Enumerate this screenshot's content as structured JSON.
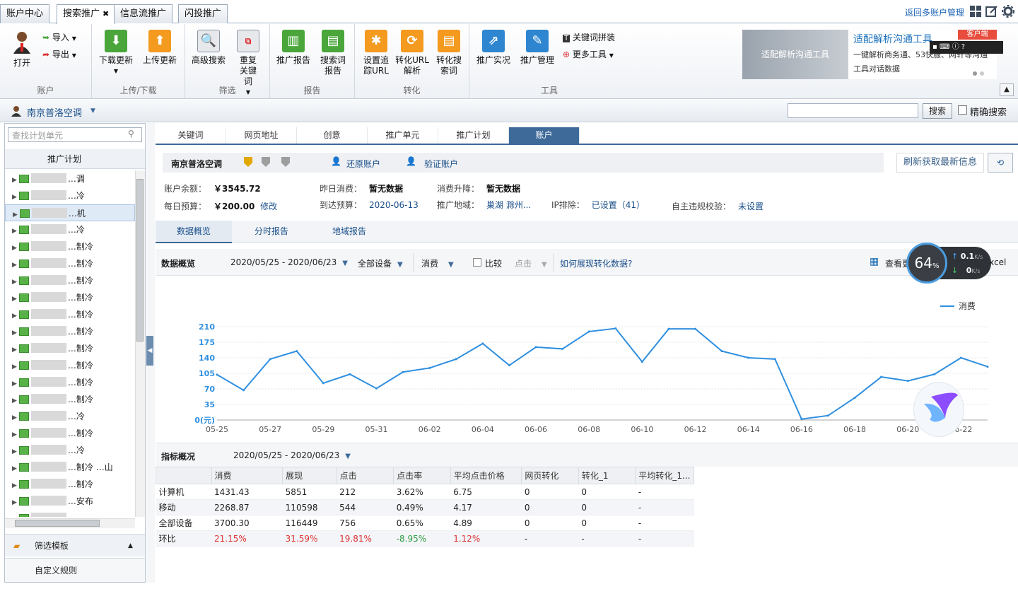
{
  "top_tabs": [
    {
      "label": "账户中心",
      "active": false
    },
    {
      "label": "搜索推广",
      "active": true,
      "closable": true
    },
    {
      "label": "信息流推广",
      "active": false
    },
    {
      "label": "闪投推广",
      "active": false
    }
  ],
  "top_right": {
    "back_link": "返回多账户管理"
  },
  "ribbon": {
    "groups": [
      {
        "label": "账户",
        "items": [
          "打开",
          "导入",
          "导出"
        ]
      },
      {
        "label": "上传/下载",
        "items": [
          "下载更新",
          "上传更新"
        ]
      },
      {
        "label": "筛选",
        "items": [
          "高级搜索",
          "重复关键词"
        ]
      },
      {
        "label": "报告",
        "items": [
          "推广报告",
          "搜索词报告"
        ]
      },
      {
        "label": "转化",
        "items": [
          "设置追踪URL",
          "转化URL解析",
          "转化搜索词"
        ]
      },
      {
        "label": "工具",
        "items": [
          "推广实况",
          "推广管理",
          "关键词拼装",
          "更多工具"
        ]
      }
    ],
    "banner": {
      "image_text": "适配解析沟通工具",
      "title": "适配解析沟通工具",
      "desc": "一键解析商务通、53快服、网轩等沟通工具对话数据",
      "badge": "客户端"
    }
  },
  "account_bar": {
    "name": "南京普洛空调",
    "search_btn": "搜索",
    "exact_label": "精确搜索"
  },
  "sidebar": {
    "search_placeholder": "查找计划单元",
    "header": "推广计划",
    "items": [
      "…调",
      "…冷",
      "…机",
      "…冷",
      "…制冷",
      "…制冷",
      "…制冷",
      "…制冷",
      "…制冷",
      "…制冷",
      "…制冷",
      "…制冷",
      "…制冷",
      "…制冷",
      "…冷",
      "…制冷",
      "…冷",
      "…制冷 …山",
      "…制冷",
      "…安布",
      "…",
      ""
    ],
    "selected_index": 2,
    "filter_template": "筛选模板",
    "custom_rules": "自定义规则"
  },
  "main": {
    "tabs": [
      "关键词",
      "网页地址",
      "创意",
      "推广单元",
      "推广计划",
      "账户"
    ],
    "active_tab": 5,
    "account_name": "南京普洛空调",
    "restore": "还原账户",
    "verify": "验证账户",
    "refresh": "刷新获取最新信息",
    "info": {
      "balance_label": "账户余额：",
      "balance": "￥3545.72",
      "yesterday_label": "昨日消费：",
      "yesterday": "暂无数据",
      "change_label": "消费升降：",
      "change": "暂无数据",
      "budget_label": "每日预算：",
      "budget": "￥200.00",
      "budget_edit": "修改",
      "reach_label": "到达预算：",
      "reach": "2020-06-13",
      "region_label": "推广地域：",
      "region": "巢湖 滁州...",
      "ip_label": "IP排除：",
      "ip": "已设置（41）",
      "selfcheck_label": "自主违规校验：",
      "selfcheck": "未设置"
    },
    "subtabs": [
      "数据概览",
      "分时报告",
      "地域报告"
    ],
    "controls": {
      "title": "数据概览",
      "date_range": "2020/05/25 - 2020/06/23",
      "device": "全部设备",
      "metric1": "消费",
      "compare": "比较",
      "metric2": "点击",
      "help": "如何展现转化数据?",
      "view_more": "查看更多",
      "excel": "excel"
    },
    "metrics_title": "指标概况",
    "metrics_date": "2020/05/25 - 2020/06/23",
    "table": {
      "headers": [
        "",
        "消费",
        "展现",
        "点击",
        "点击率",
        "平均点击价格",
        "网页转化",
        "转化_1",
        "平均转化_1..."
      ],
      "rows": [
        [
          "计算机",
          "1431.43",
          "5851",
          "212",
          "3.62%",
          "6.75",
          "0",
          "0",
          "-"
        ],
        [
          "移动",
          "2268.87",
          "110598",
          "544",
          "0.49%",
          "4.17",
          "0",
          "0",
          "-"
        ],
        [
          "全部设备",
          "3700.30",
          "116449",
          "756",
          "0.65%",
          "4.89",
          "0",
          "0",
          "-"
        ],
        [
          "环比",
          "21.15%",
          "31.59%",
          "19.81%",
          "-8.95%",
          "1.12%",
          "-",
          "-",
          "-"
        ]
      ]
    }
  },
  "net_widget": {
    "percent": "64",
    "unit": "%",
    "up": "0.1",
    "down": "0",
    "speed_unit": "K/s"
  },
  "chart_data": {
    "type": "line",
    "legend": "消费",
    "legend_position": "top-right",
    "ylabel_unit": "(元)",
    "ylim": [
      0,
      210
    ],
    "yticks": [
      0,
      35,
      70,
      105,
      140,
      175,
      210
    ],
    "x": [
      "05-25",
      "05-26",
      "05-27",
      "05-28",
      "05-29",
      "05-30",
      "05-31",
      "06-01",
      "06-02",
      "06-03",
      "06-04",
      "06-05",
      "06-06",
      "06-07",
      "06-08",
      "06-09",
      "06-10",
      "06-11",
      "06-12",
      "06-13",
      "06-14",
      "06-15",
      "06-16",
      "06-17",
      "06-18",
      "06-19",
      "06-20",
      "06-21",
      "06-22",
      "06-23"
    ],
    "x_tick_labels": [
      "05-25",
      "05-27",
      "05-29",
      "05-31",
      "06-02",
      "06-04",
      "06-06",
      "06-08",
      "06-10",
      "06-12",
      "06-14",
      "06-16",
      "06-18",
      "06-20",
      "06-22"
    ],
    "series": [
      {
        "name": "消费",
        "color": "#2f8fe0",
        "values": [
          102,
          67,
          137,
          155,
          83,
          103,
          71,
          108,
          117,
          137,
          172,
          123,
          164,
          160,
          199,
          206,
          131,
          205,
          205,
          155,
          140,
          137,
          2,
          10,
          50,
          97,
          88,
          103,
          140,
          120
        ]
      }
    ]
  }
}
